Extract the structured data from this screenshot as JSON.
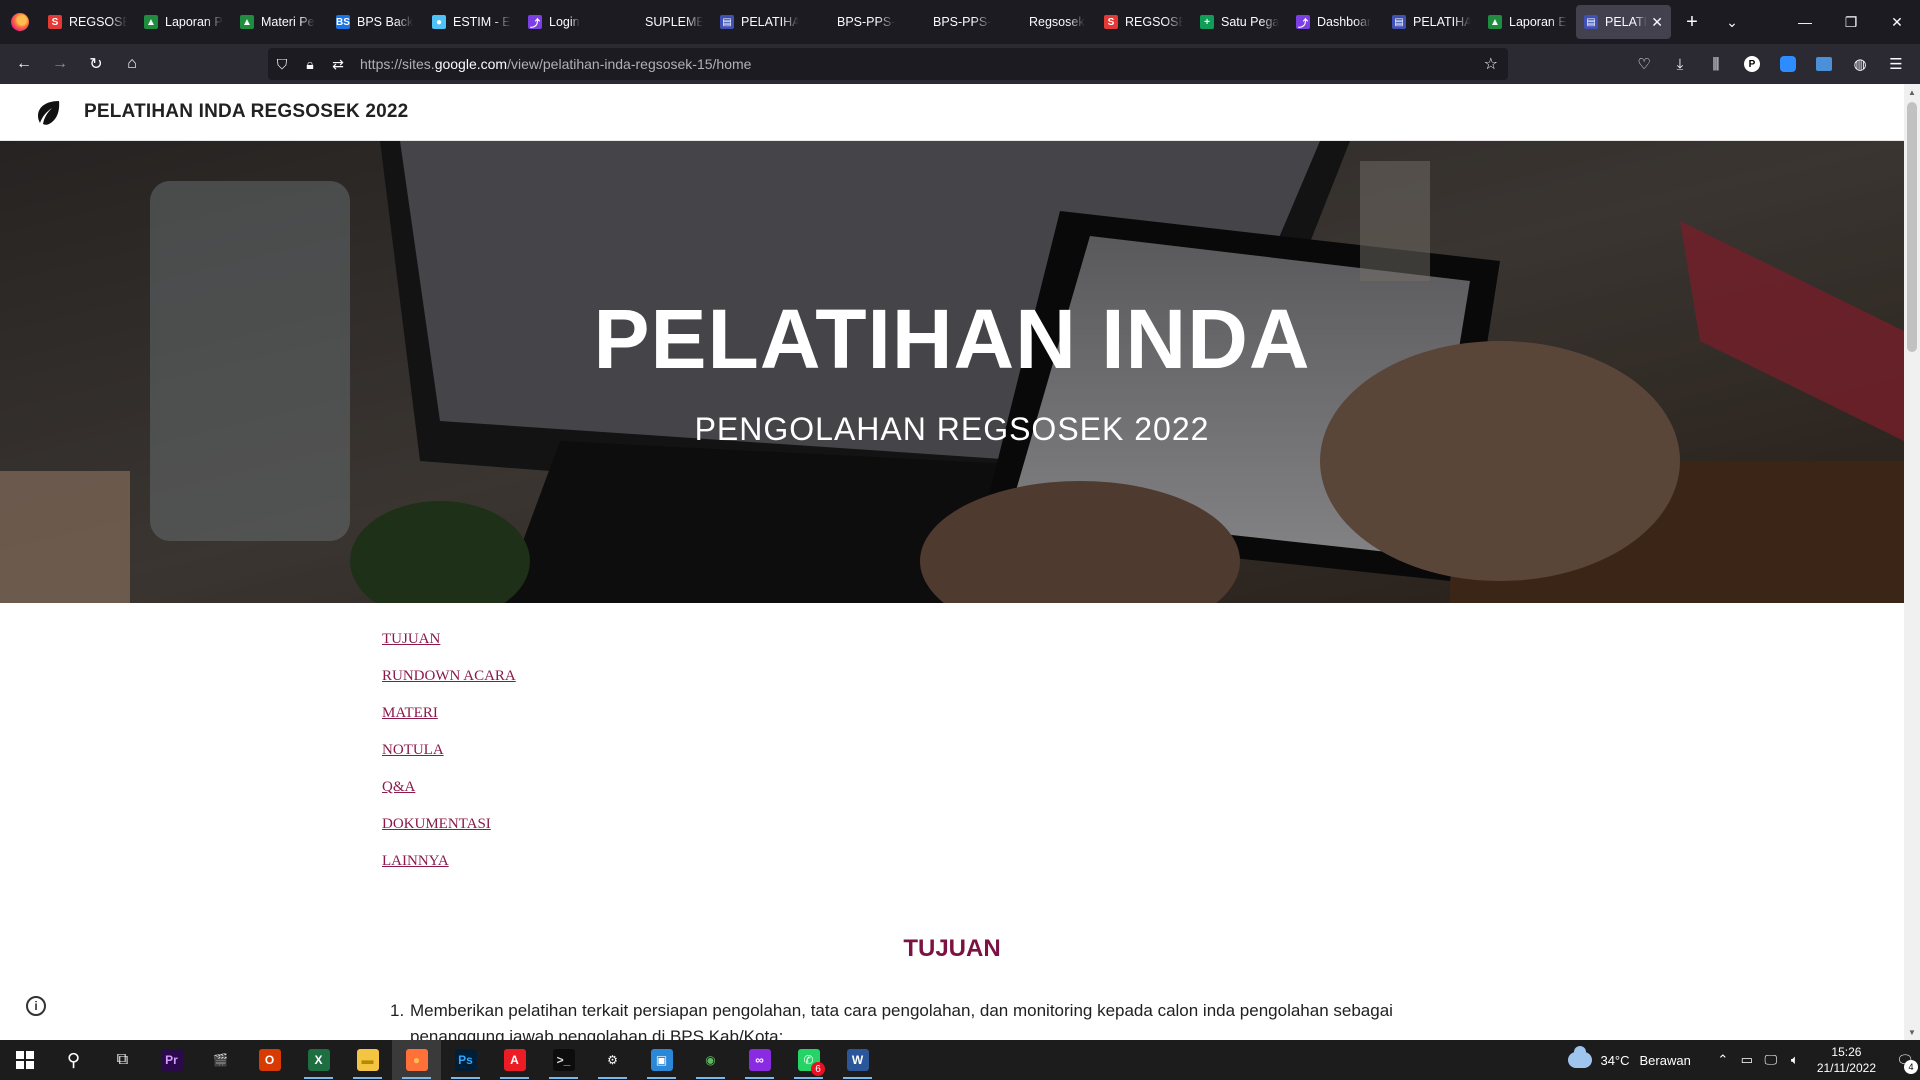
{
  "browser": {
    "tabs": [
      {
        "title": "REGSOSEK",
        "favicon_color": "#e53935",
        "favicon_glyph": "S",
        "icon": "site-s-icon"
      },
      {
        "title": "Laporan P",
        "favicon_color": "#1e8e3e",
        "favicon_glyph": "▲",
        "icon": "google-drive-icon"
      },
      {
        "title": "Materi Pe",
        "favicon_color": "#1e8e3e",
        "favicon_glyph": "▲",
        "icon": "google-drive-icon"
      },
      {
        "title": "BPS Back",
        "favicon_color": "#1a73e8",
        "favicon_glyph": "BS",
        "icon": "bps-icon"
      },
      {
        "title": "ESTIM - E",
        "favicon_color": "#4fc3f7",
        "favicon_glyph": "●",
        "icon": "estim-icon"
      },
      {
        "title": "Login",
        "favicon_color": "#7b3fe4",
        "favicon_glyph": "⤴",
        "icon": "looker-icon"
      },
      {
        "title": "SUPLEMEN P",
        "favicon_color": "#1c1b22",
        "favicon_glyph": "",
        "icon": "blank-page-icon"
      },
      {
        "title": "PELATIHA",
        "favicon_color": "#3f51b5",
        "favicon_glyph": "▤",
        "icon": "google-sites-icon"
      },
      {
        "title": "BPS-PPS-Wilk",
        "favicon_color": "#1c1b22",
        "favicon_glyph": "",
        "icon": "blank-page-icon"
      },
      {
        "title": "BPS-PPS-Wilk",
        "favicon_color": "#1c1b22",
        "favicon_glyph": "",
        "icon": "blank-page-icon"
      },
      {
        "title": "Regsosek",
        "favicon_color": "#1c1b22",
        "favicon_glyph": "",
        "icon": "blank-page-icon"
      },
      {
        "title": "REGSOSEK",
        "favicon_color": "#e53935",
        "favicon_glyph": "S",
        "icon": "site-s-icon"
      },
      {
        "title": "Satu Pega",
        "favicon_color": "#0f9d58",
        "favicon_glyph": "+",
        "icon": "google-sheets-icon"
      },
      {
        "title": "Dashboar",
        "favicon_color": "#7b3fe4",
        "favicon_glyph": "⤴",
        "icon": "looker-icon"
      },
      {
        "title": "PELATIHA",
        "favicon_color": "#3f51b5",
        "favicon_glyph": "▤",
        "icon": "google-sites-icon"
      },
      {
        "title": "Laporan E",
        "favicon_color": "#1e8e3e",
        "favicon_glyph": "▲",
        "icon": "google-drive-icon"
      },
      {
        "title": "PELATI",
        "favicon_color": "#3f51b5",
        "favicon_glyph": "▤",
        "icon": "google-sites-icon",
        "active": true
      }
    ],
    "url_domain_prefix": "https://sites.",
    "url_domain": "google.com",
    "url_path": "/view/pelatihan-inda-regsosek-15/home"
  },
  "site": {
    "header_title": "PELATIHAN INDA REGSOSEK 2022",
    "hero_title": "PELATIHAN INDA",
    "hero_subtitle": "PENGOLAHAN REGSOSEK 2022",
    "toc": [
      "TUJUAN",
      "RUNDOWN ACARA",
      "MATERI",
      "NOTULA",
      "Q&A",
      "DOKUMENTASI",
      "LAINNYA"
    ],
    "section_title": "TUJUAN",
    "list_num": "1.",
    "list_text": "Memberikan pelatihan terkait persiapan pengolahan, tata cara pengolahan, dan monitoring kepada calon inda pengolahan sebagai penanggung jawab pengolahan di BPS Kab/Kota;",
    "link_color": "#8b1a4a",
    "section_color": "#7b1241"
  },
  "taskbar": {
    "apps": [
      {
        "name": "premiere",
        "label": "Pr",
        "color": "#2a0a4a",
        "fg": "#d69bff",
        "running": false
      },
      {
        "name": "clapper",
        "label": "🎬",
        "color": "#1c1c1c",
        "fg": "#fff",
        "running": false
      },
      {
        "name": "office",
        "label": "O",
        "color": "#d83b01",
        "fg": "#fff",
        "running": false
      },
      {
        "name": "excel",
        "label": "X",
        "color": "#1d6f42",
        "fg": "#fff",
        "running": true
      },
      {
        "name": "file-explorer",
        "label": "▬",
        "color": "#f4c542",
        "fg": "#b58a00",
        "running": true
      },
      {
        "name": "firefox",
        "label": "●",
        "color": "#ff7139",
        "fg": "#ffbd4f",
        "running": true,
        "active": true
      },
      {
        "name": "photoshop",
        "label": "Ps",
        "color": "#001e36",
        "fg": "#31a8ff",
        "running": true
      },
      {
        "name": "acrobat",
        "label": "A",
        "color": "#ec1c24",
        "fg": "#fff",
        "running": true
      },
      {
        "name": "terminal",
        "label": ">_",
        "color": "#0c0c0c",
        "fg": "#ddd",
        "running": true
      },
      {
        "name": "settings",
        "label": "⚙",
        "color": "#1c1c1c",
        "fg": "#fff",
        "running": true
      },
      {
        "name": "remote-desktop",
        "label": "▣",
        "color": "#2b88d8",
        "fg": "#fff",
        "running": true
      },
      {
        "name": "globe-app",
        "label": "◉",
        "color": "#1c1c1c",
        "fg": "#5fb85f",
        "running": true
      },
      {
        "name": "vpn-app",
        "label": "∞",
        "color": "#8a2be2",
        "fg": "#fff",
        "running": true
      },
      {
        "name": "whatsapp",
        "label": "✆",
        "color": "#25d366",
        "fg": "#fff",
        "running": true,
        "badge": "6"
      },
      {
        "name": "word",
        "label": "W",
        "color": "#2b579a",
        "fg": "#fff",
        "running": true
      }
    ],
    "weather_temp": "34°C",
    "weather_text": "Berawan",
    "time": "15:26",
    "date": "21/11/2022",
    "notif_count": "4"
  }
}
